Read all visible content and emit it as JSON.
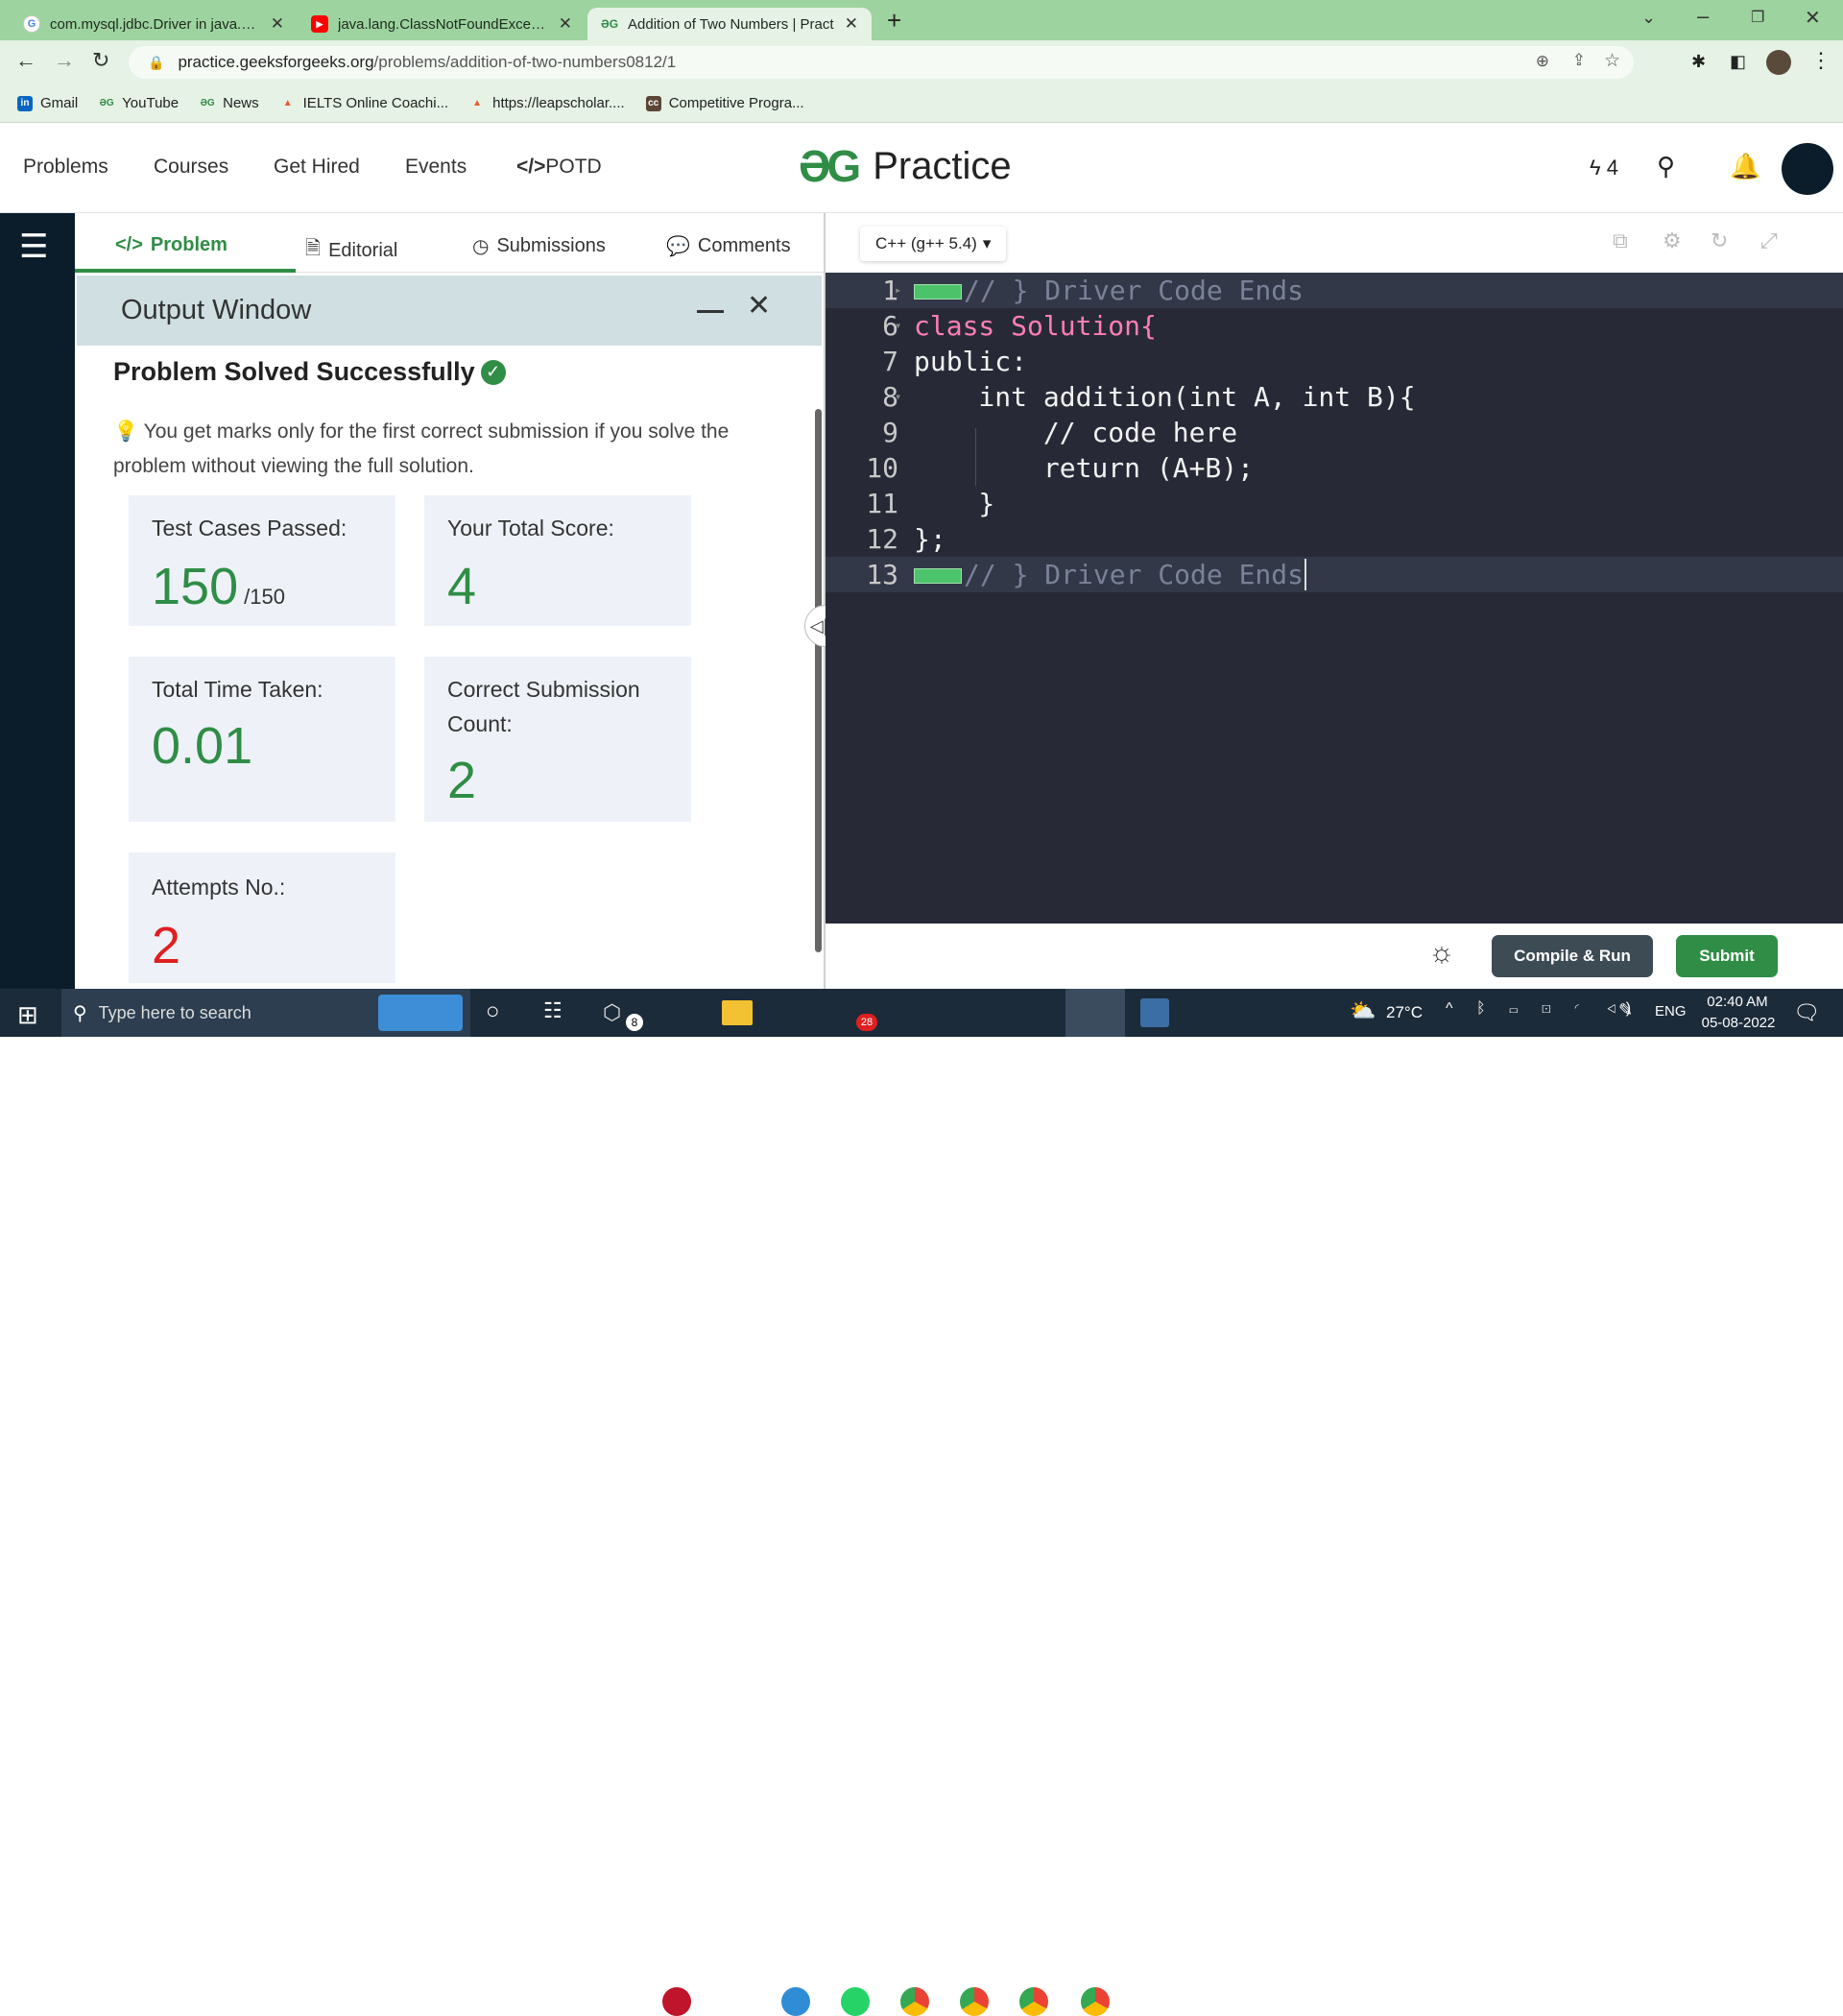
{
  "browser": {
    "tabs": [
      {
        "title": "com.mysql.jdbc.Driver in java.bas",
        "icon": "google-icon"
      },
      {
        "title": "java.lang.ClassNotFoundExceptio",
        "icon": "youtube-icon"
      },
      {
        "title": "Addition of Two Numbers | Pract",
        "icon": "gfg-icon",
        "active": true
      }
    ],
    "url_domain": "practice.geeksforgeeks.org",
    "url_path": "/problems/addition-of-two-numbers0812/1",
    "bookmarks": [
      {
        "label": "Gmail",
        "icon": "linkedin-icon"
      },
      {
        "label": "YouTube",
        "icon": "gfg-icon"
      },
      {
        "label": "News",
        "icon": "gfg-icon"
      },
      {
        "label": "IELTS Online Coachi...",
        "icon": "leap-icon"
      },
      {
        "label": "https://leapscholar....",
        "icon": "leap-icon"
      },
      {
        "label": "Competitive Progra...",
        "icon": "cc-icon"
      }
    ]
  },
  "header": {
    "nav": [
      "Problems",
      "Courses",
      "Get Hired",
      "Events",
      "POTD"
    ],
    "potd_symbol": "</>",
    "logo_text": "Practice",
    "streak": "4"
  },
  "problem_tabs": [
    {
      "label": "Problem",
      "icon": "code-icon",
      "active": true
    },
    {
      "label": "Editorial",
      "icon": "document-icon"
    },
    {
      "label": "Submissions",
      "icon": "clock-icon"
    },
    {
      "label": "Comments",
      "icon": "comment-icon"
    }
  ],
  "output": {
    "title": "Output Window",
    "status": "Problem Solved Successfully",
    "tip": "You get marks only for the first correct submission if you solve the problem without viewing the full solution.",
    "cards": {
      "test_cases": {
        "label": "Test Cases Passed:",
        "value": "150",
        "suffix": "/150"
      },
      "score": {
        "label": "Your Total Score:",
        "value": "4"
      },
      "time": {
        "label": "Total Time Taken:",
        "value": "0.01"
      },
      "submissions": {
        "label": "Correct Submission Count:",
        "value": "2"
      },
      "attempts": {
        "label": "Attempts No.:",
        "value": "2"
      }
    }
  },
  "editor": {
    "language": "C++ (g++ 5.4)",
    "lines": [
      {
        "num": "1",
        "text": "// } Driver Code Ends",
        "style": "comment",
        "folded": true
      },
      {
        "num": "6",
        "text": "class Solution{",
        "style": "class"
      },
      {
        "num": "7",
        "text": "public:",
        "style": "public"
      },
      {
        "num": "8",
        "text": "    int addition(int A, int B){",
        "style": "plain"
      },
      {
        "num": "9",
        "text": "        // code here",
        "style": "comment"
      },
      {
        "num": "10",
        "text": "        return (A+B);",
        "style": "return"
      },
      {
        "num": "11",
        "text": "    }",
        "style": "plain"
      },
      {
        "num": "12",
        "text": "};",
        "style": "plain"
      },
      {
        "num": "13",
        "text": "// } Driver Code Ends",
        "style": "comment",
        "folded": true
      }
    ],
    "compile_label": "Compile & Run",
    "submit_label": "Submit"
  },
  "taskbar": {
    "search_placeholder": "Type here to search",
    "badge_8": "8",
    "badge_28": "28",
    "weather": "27°C",
    "lang": "ENG",
    "time": "02:40 AM",
    "date": "05-08-2022"
  },
  "colors": {
    "brand": "#2f8d46",
    "attempts": "#e02020",
    "chrome": "#9dd39f"
  }
}
